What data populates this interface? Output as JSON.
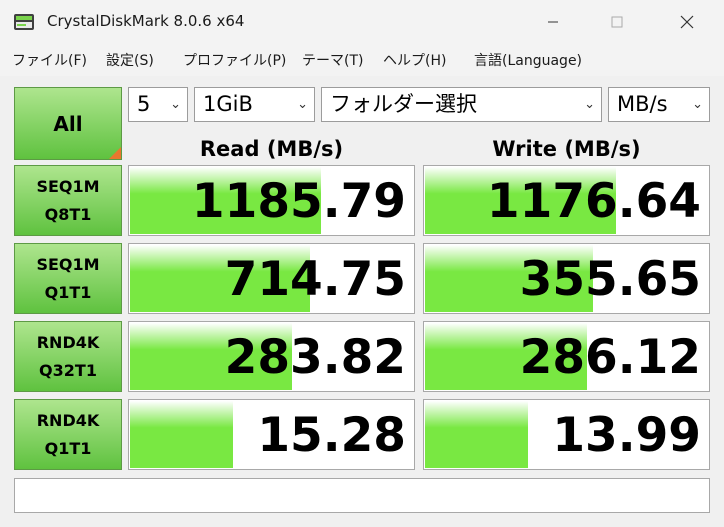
{
  "window": {
    "title": "CrystalDiskMark 8.0.6 x64",
    "icon": "crystaldiskmark-icon",
    "controls": [
      "minimize",
      "maximize",
      "close"
    ]
  },
  "menu": [
    {
      "label": "ファイル(F)"
    },
    {
      "label": "設定(S)"
    },
    {
      "label": "プロファイル(P)"
    },
    {
      "label": "テーマ(T)"
    },
    {
      "label": "ヘルプ(H)"
    },
    {
      "label": "言語(Language)"
    }
  ],
  "controls": {
    "all_label": "All",
    "count": "5",
    "size": "1GiB",
    "target": "フォルダー選択",
    "unit": "MB/s"
  },
  "headers": {
    "read": "Read (MB/s)",
    "write": "Write (MB/s)"
  },
  "tests": [
    {
      "line1": "SEQ1M",
      "line2": "Q8T1",
      "read": "1185.79",
      "write": "1176.64",
      "read_fill": 0.67,
      "write_fill": 0.67
    },
    {
      "line1": "SEQ1M",
      "line2": "Q1T1",
      "read": "714.75",
      "write": "355.65",
      "read_fill": 0.63,
      "write_fill": 0.59
    },
    {
      "line1": "RND4K",
      "line2": "Q32T1",
      "read": "283.82",
      "write": "286.12",
      "read_fill": 0.57,
      "write_fill": 0.57
    },
    {
      "line1": "RND4K",
      "line2": "Q1T1",
      "read": "15.28",
      "write": "13.99",
      "read_fill": 0.36,
      "write_fill": 0.36
    }
  ],
  "status_text": "",
  "colors": {
    "accent_green": "#79e842",
    "button_green": "#5fc23f",
    "corner_orange": "#e8772e"
  }
}
